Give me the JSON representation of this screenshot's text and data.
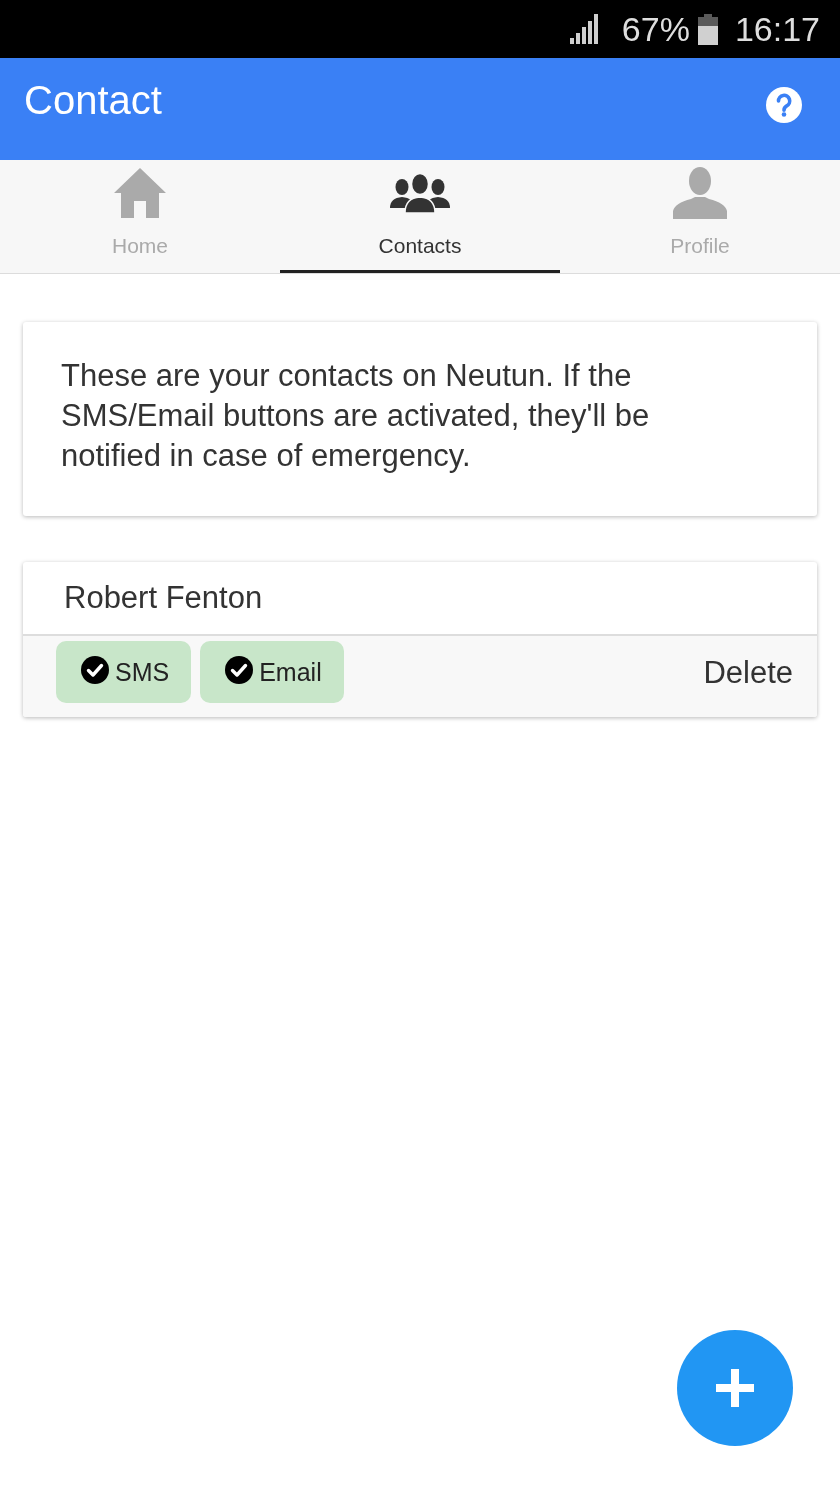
{
  "status_bar": {
    "battery": "67%",
    "time": "16:17"
  },
  "app_bar": {
    "title": "Contact"
  },
  "tabs": [
    {
      "label": "Home",
      "selected": false
    },
    {
      "label": "Contacts",
      "selected": true
    },
    {
      "label": "Profile",
      "selected": false
    }
  ],
  "info_card": {
    "text": "These are your contacts on Neutun. If the SMS/Email buttons are activated, they'll be notified in case of emergency."
  },
  "contacts": [
    {
      "name": "Robert Fenton",
      "channels": [
        {
          "label": "SMS",
          "on": true
        },
        {
          "label": "Email",
          "on": true
        }
      ],
      "delete": "Delete"
    }
  ]
}
